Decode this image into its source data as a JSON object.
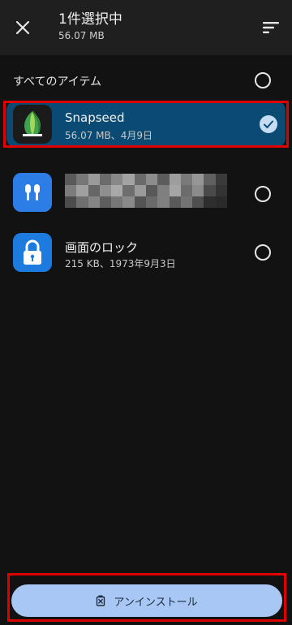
{
  "header": {
    "close_icon": "close-icon",
    "title": "1件選択中",
    "subtitle": "56.07 MB",
    "sort_icon": "sort-icon"
  },
  "select_all": {
    "label": "すべてのアイテム",
    "checked": false
  },
  "apps": [
    {
      "name": "Snapseed",
      "meta": "56.07 MB、4月9日",
      "icon": "snapseed-icon",
      "selected": true
    },
    {
      "name": "",
      "meta": "",
      "icon": "earbuds-icon",
      "selected": false,
      "obscured": true
    },
    {
      "name": "画面のロック",
      "meta": "215 KB、1973年9月3日",
      "icon": "lock-icon",
      "selected": false
    }
  ],
  "footer": {
    "uninstall_label": "アンインストール",
    "uninstall_icon": "trash-icon"
  },
  "colors": {
    "background": "#121212",
    "header": "#1f1f1f",
    "selected_row": "#0b4a72",
    "uninstall_button": "#a8c7f5",
    "highlight_outline": "#e00000"
  }
}
